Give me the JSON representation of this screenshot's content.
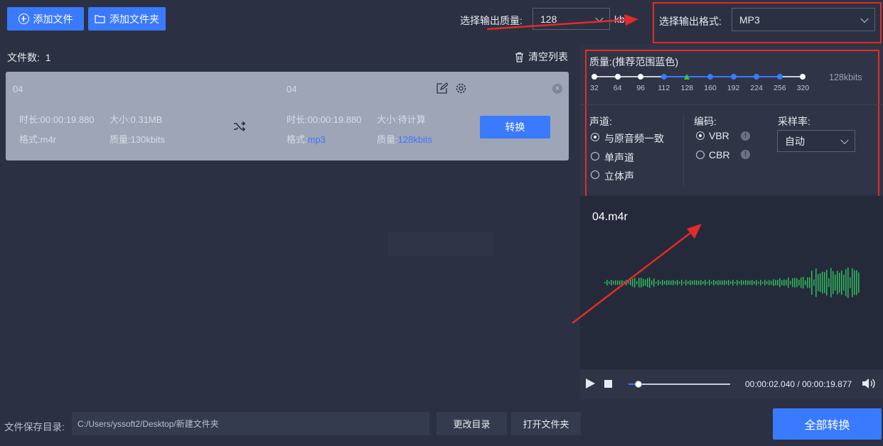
{
  "toolbar": {
    "add_file": "添加文件",
    "add_folder": "添加文件夹",
    "quality_label": "选择输出质量:",
    "quality_value": "128",
    "quality_unit": "kbit",
    "format_label": "选择输出格式:",
    "format_value": "MP3"
  },
  "list": {
    "count_label": "文件数:",
    "count": "1",
    "clear_label": "清空列表"
  },
  "file": {
    "source_name": "04",
    "target_name": "04",
    "source": {
      "duration_label": "时长:",
      "duration": "00:00:19.880",
      "size_label": "大小:",
      "size": "0.31MB",
      "format_label": "格式:",
      "format": "m4r",
      "quality_label": "质量:",
      "quality": "130kbits"
    },
    "target": {
      "duration_label": "时长:",
      "duration": "00:00:19.880",
      "size_label": "大小:",
      "size": "待计算",
      "format_label": "格式:",
      "format": "mp3",
      "quality_label": "质量:",
      "quality": "128kbits"
    },
    "convert_label": "转换"
  },
  "settings": {
    "quality_title": "质量:(推荐范围蓝色)",
    "quality_display": "128kbits",
    "quality_ticks": [
      "32",
      "64",
      "96",
      "112",
      "128",
      "160",
      "192",
      "224",
      "256",
      "320"
    ],
    "selected_tick": "128",
    "channel_label": "声道:",
    "channel_options": [
      "与原音频一致",
      "单声道",
      "立体声"
    ],
    "channel_selected": "与原音频一致",
    "encoding_label": "编码:",
    "encoding_options": [
      "VBR",
      "CBR"
    ],
    "encoding_selected": "VBR",
    "sample_rate_label": "采样率:",
    "sample_rate_value": "自动"
  },
  "preview": {
    "filename": "04.m4r",
    "time_current": "00:00:02.040",
    "time_separator": " / ",
    "time_total": "00:00:19.877",
    "progress": 0.1
  },
  "footer": {
    "save_dir_label": "文件保存目录:",
    "save_dir_path": "C:/Users/yssoft2/Desktop/新建文件夹",
    "change_dir": "更改目录",
    "open_folder": "打开文件夹",
    "convert_all": "全部转换"
  },
  "colors": {
    "accent": "#3a7afe",
    "highlight": "#e52a2a",
    "waveform": "#2fb45a",
    "selected_tick": "#3fbf3f"
  }
}
